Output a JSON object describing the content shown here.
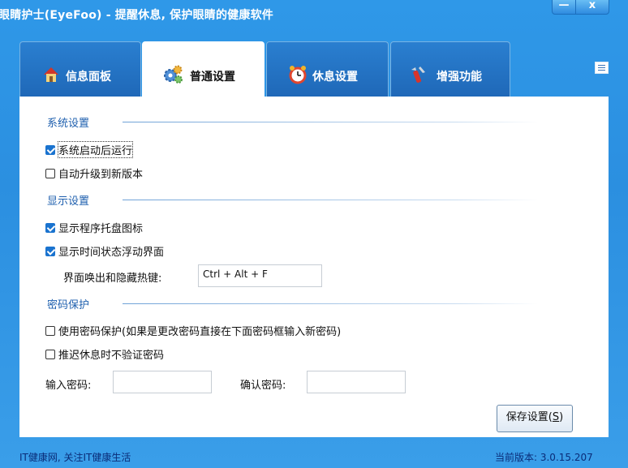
{
  "window": {
    "title": "眼睛护士(EyeFoo) - 提醒休息, 保护眼睛的健康软件",
    "minimize_glyph": "—",
    "close_glyph": "x"
  },
  "tabs": [
    {
      "label": "信息面板",
      "icon": "house-icon",
      "active": false
    },
    {
      "label": "普通设置",
      "icon": "gears-icon",
      "active": true
    },
    {
      "label": "休息设置",
      "icon": "alarm-clock-icon",
      "active": false
    },
    {
      "label": "增强功能",
      "icon": "multitool-icon",
      "active": false
    }
  ],
  "sections": {
    "system": {
      "title": "系统设置",
      "items": [
        {
          "label": "系统启动后运行",
          "checked": true
        },
        {
          "label": "自动升级到新版本",
          "checked": false
        }
      ]
    },
    "display": {
      "title": "显示设置",
      "items": [
        {
          "label": "显示程序托盘图标",
          "checked": true
        },
        {
          "label": "显示时间状态浮动界面",
          "checked": true
        }
      ],
      "hotkey_label": "界面唤出和隐藏热键:",
      "hotkey_value": "Ctrl + Alt + F"
    },
    "password": {
      "title": "密码保护",
      "items": [
        {
          "label": "使用密码保护(如果是更改密码直接在下面密码框输入新密码)",
          "checked": false
        },
        {
          "label": "推迟休息时不验证密码",
          "checked": false
        }
      ],
      "input_label": "输入密码:",
      "confirm_label": "确认密码:",
      "input_value": "",
      "confirm_value": ""
    }
  },
  "save_button": {
    "text": "保存设置(",
    "accel": "S",
    "close": ")"
  },
  "footer": {
    "left": "IT健康网, 关注IT健康生活",
    "right": "当前版本: 3.0.15.207"
  },
  "colors": {
    "accent": "#1a73cf",
    "title_blue": "#2f98e8",
    "section_text": "#1e5fae",
    "footer_text": "#0a2c78"
  }
}
